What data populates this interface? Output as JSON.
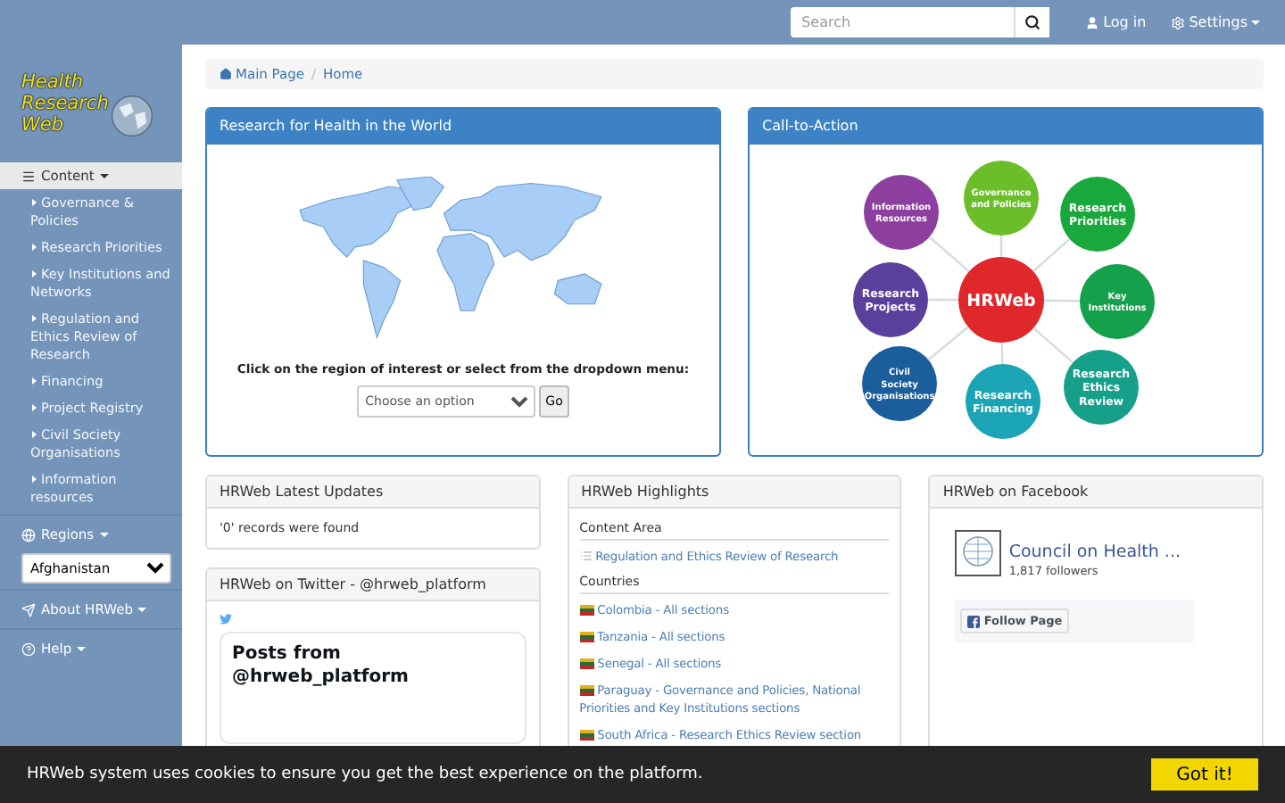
{
  "navbar": {
    "search": {
      "placeholder": "Search"
    },
    "login": "Log in",
    "settings": "Settings"
  },
  "logo": {
    "lines": [
      "Health",
      "Research",
      "Web"
    ]
  },
  "sidebar": {
    "content_menu": {
      "label": "Content",
      "expanded": true,
      "items": [
        "Governance & Policies",
        "Research Priorities",
        "Key Institutions and Networks",
        "Regulation and Ethics Review of Research",
        "Financing",
        "Project Registry",
        "Civil Society Organisations",
        "Information resources"
      ]
    },
    "regions": {
      "label": "Regions",
      "value": "Afghanistan"
    },
    "about": "About HRWeb",
    "help": "Help"
  },
  "breadcrumb": {
    "items": [
      "Main Page",
      "Home"
    ],
    "separator": "/"
  },
  "world_panel": {
    "title": "Research for Health in the World",
    "instruction": "Click on the region of interest or select from the dropdown menu:",
    "select": {
      "placeholder": "Choose an option"
    },
    "button": "Go"
  },
  "cta_panel": {
    "title": "Call-to-Action",
    "center": "HRWeb",
    "nodes": [
      {
        "lines": [
          "Governance",
          "and Policies"
        ],
        "color": "#6cbd2a"
      },
      {
        "lines": [
          "Information",
          "Resources"
        ],
        "color": "#8c3f9f"
      },
      {
        "lines": [
          "Research",
          "Priorities"
        ],
        "color": "#19a83c"
      },
      {
        "lines": [
          "Research",
          "Projects"
        ],
        "color": "#5a3f9c"
      },
      {
        "lines": [
          "Key",
          "Institutions"
        ],
        "color": "#15a04c"
      },
      {
        "lines": [
          "Civil",
          "Society",
          "Organisations"
        ],
        "color": "#1a5e9c"
      },
      {
        "lines": [
          "Research",
          "Ethics",
          "Review"
        ],
        "color": "#16a08a"
      },
      {
        "lines": [
          "Research",
          "Financing"
        ],
        "color": "#1ba4b4"
      }
    ]
  },
  "updates": {
    "title": "HRWeb Latest Updates",
    "message": "'0' records were found"
  },
  "twitter": {
    "title": "HRWeb on Twitter - @hrweb_platform",
    "posts_title": "Posts from @hrweb_platform"
  },
  "highlights": {
    "title": "HRWeb Highlights",
    "content_heading": "Content Area",
    "content_links": [
      "Regulation and Ethics Review of Research"
    ],
    "countries_heading": "Countries",
    "countries": [
      "Colombia - All sections",
      "Tanzania - All sections",
      "Senegal - All sections",
      "Paraguay - Governance and Policies, National Priorities and Key Institutions sections",
      "South Africa - Research Ethics Review section"
    ]
  },
  "facebook": {
    "title": "HRWeb on Facebook",
    "page_name": "Council on Health ...",
    "followers": "1,817 followers",
    "button": "Follow Page"
  },
  "cookie": {
    "text": "HRWeb system uses cookies to ensure you get the best experience on the platform.",
    "button": "Got it!"
  }
}
